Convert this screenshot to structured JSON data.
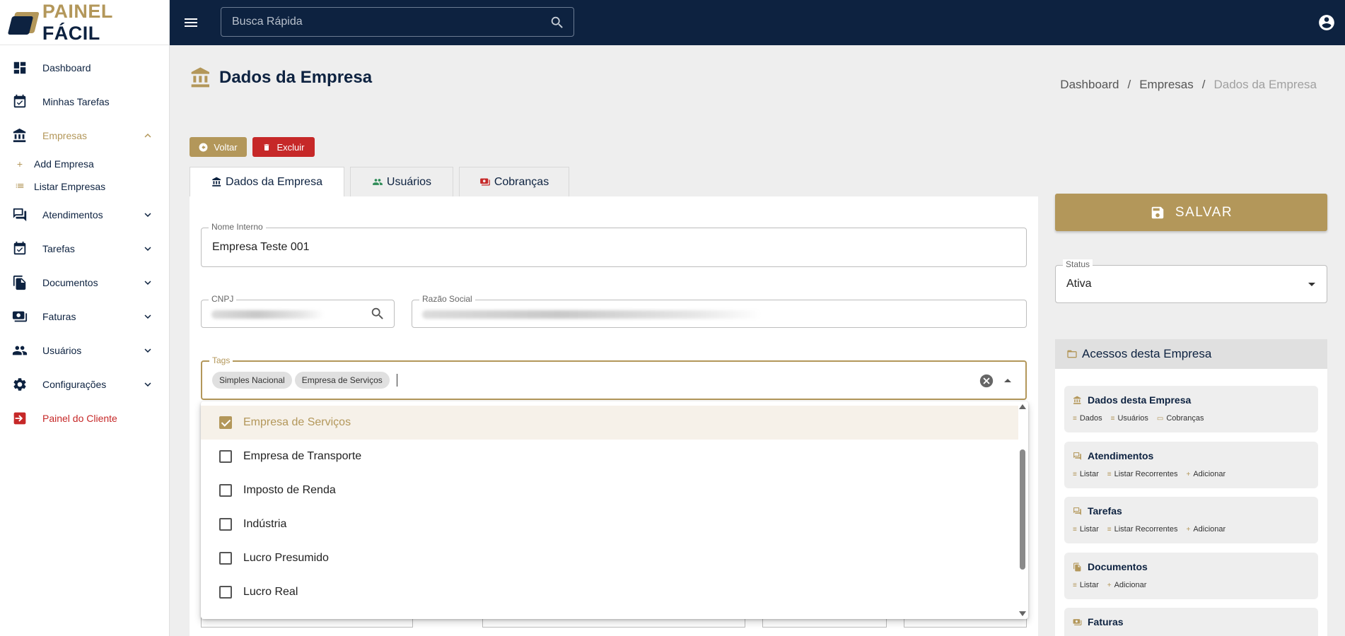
{
  "logo": {
    "part1": "PAINEL",
    "part2": "FÁCIL"
  },
  "search": {
    "placeholder": "Busca Rápida"
  },
  "sidebar": {
    "items": [
      {
        "label": "Dashboard",
        "icon": "dashboard-icon"
      },
      {
        "label": "Minhas Tarefas",
        "icon": "calendar-check-icon"
      },
      {
        "label": "Empresas",
        "icon": "bank-icon"
      },
      {
        "label": "Atendimentos",
        "icon": "chat-icon"
      },
      {
        "label": "Tarefas",
        "icon": "calendar-check-icon"
      },
      {
        "label": "Documentos",
        "icon": "document-icon"
      },
      {
        "label": "Faturas",
        "icon": "billing-icon"
      },
      {
        "label": "Usuários",
        "icon": "group-icon"
      },
      {
        "label": "Configurações",
        "icon": "gear-icon"
      },
      {
        "label": "Painel do Cliente",
        "icon": "exit-icon"
      }
    ],
    "sub_items": [
      {
        "label": "Add Empresa",
        "icon": "plus-icon"
      },
      {
        "label": "Listar Empresas",
        "icon": "list-icon"
      }
    ]
  },
  "page": {
    "title": "Dados da Empresa"
  },
  "breadcrumb": {
    "items": [
      "Dashboard",
      "Empresas",
      "Dados da Empresa"
    ]
  },
  "actions": {
    "back": "Voltar",
    "delete": "Excluir"
  },
  "tabs": [
    {
      "label": "Dados da Empresa"
    },
    {
      "label": "Usuários"
    },
    {
      "label": "Cobranças"
    }
  ],
  "form": {
    "nome_interno": {
      "label": "Nome Interno",
      "value": "Empresa Teste 001"
    },
    "cnpj": {
      "label": "CNPJ"
    },
    "razao_social": {
      "label": "Razão Social"
    },
    "tags": {
      "label": "Tags",
      "chips": [
        "Simples Nacional",
        "Empresa de Serviços"
      ]
    }
  },
  "dropdown": {
    "options": [
      {
        "label": "Empresa de Serviços",
        "checked": true
      },
      {
        "label": "Empresa de Transporte",
        "checked": false
      },
      {
        "label": "Imposto de Renda",
        "checked": false
      },
      {
        "label": "Indústria",
        "checked": false
      },
      {
        "label": "Lucro Presumido",
        "checked": false
      },
      {
        "label": "Lucro Real",
        "checked": false
      }
    ]
  },
  "save": {
    "label": "SALVAR"
  },
  "status": {
    "label": "Status",
    "value": "Ativa"
  },
  "access": {
    "title": "Acessos desta Empresa",
    "cards": [
      {
        "title": "Dados desta Empresa",
        "links": [
          "Dados",
          "Usuários",
          "Cobranças"
        ]
      },
      {
        "title": "Atendimentos",
        "links": [
          "Listar",
          "Listar Recorrentes",
          "Adicionar"
        ]
      },
      {
        "title": "Tarefas",
        "links": [
          "Listar",
          "Listar Recorrentes",
          "Adicionar"
        ]
      },
      {
        "title": "Documentos",
        "links": [
          "Listar",
          "Adicionar"
        ]
      },
      {
        "title": "Faturas",
        "links": []
      }
    ]
  },
  "colors": {
    "navy": "#0d2240",
    "gold": "#b3975a",
    "red": "#c62828"
  }
}
